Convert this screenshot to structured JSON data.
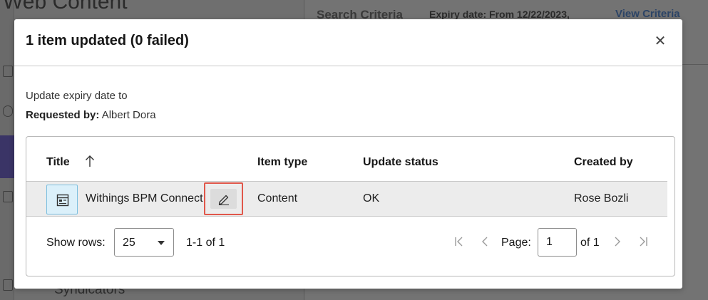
{
  "background": {
    "title_fragment": "Web Content",
    "search_criteria_label": "Search Criteria",
    "expiry_fragment": "Expiry date: From 12/22/2023,",
    "view_criteria_link": "View Criteria",
    "syndicators_fragment": "Syndicators"
  },
  "modal": {
    "title": "1 item updated (0 failed)",
    "close_icon": "close-icon",
    "description": "Update expiry date to",
    "requested_by_label": "Requested by:",
    "requested_by_value": "Albert Dora"
  },
  "table": {
    "columns": [
      "Title",
      "Item type",
      "Update status",
      "Created by"
    ],
    "rows": [
      {
        "icon": "content-item-icon",
        "title": "Withings BPM Connect",
        "item_type": "Content",
        "update_status": "OK",
        "created_by": "Rose Bozli"
      }
    ]
  },
  "pagination": {
    "show_rows_label": "Show rows:",
    "rows_per_page": "25",
    "range_text": "1-1 of 1",
    "page_label": "Page:",
    "current_page": "1",
    "of_total": "of 1"
  },
  "colors": {
    "highlight_border": "#e0574a",
    "icon_bg": "#dbf0fa",
    "row_bg": "#ececec"
  }
}
